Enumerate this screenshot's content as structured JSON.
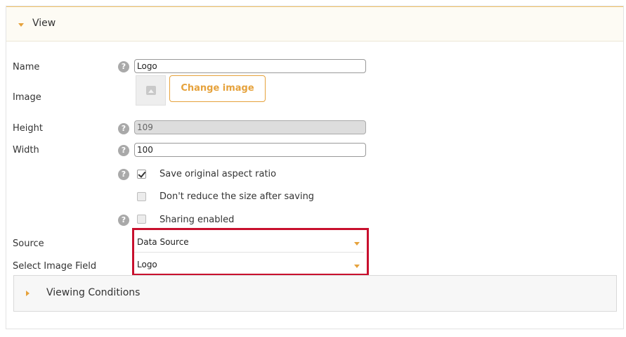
{
  "view_panel": {
    "title": "View"
  },
  "fields": {
    "name": {
      "label": "Name",
      "value": "Logo"
    },
    "image": {
      "label": "Image",
      "button_label": "Change image"
    },
    "height": {
      "label": "Height",
      "value": "109"
    },
    "width": {
      "label": "Width",
      "value": "100"
    },
    "source": {
      "label": "Source",
      "value": "Data Source"
    },
    "select_image_field": {
      "label": "Select Image Field",
      "value": "Logo"
    }
  },
  "checkboxes": {
    "save_aspect_ratio": {
      "label": "Save original aspect ratio",
      "checked": true
    },
    "dont_reduce_size": {
      "label": "Don't reduce the size after saving",
      "checked": false
    },
    "sharing_enabled": {
      "label": "Sharing enabled",
      "checked": false
    }
  },
  "help_icon": {
    "glyph": "?"
  },
  "viewing_conditions": {
    "title": "Viewing Conditions"
  },
  "colors": {
    "accent": "#e6a23c",
    "highlight": "#c8102e",
    "help_icon": "#a9a9a9"
  },
  "icons": {
    "expand_down": "triangle-down-icon",
    "collapse_right": "triangle-right-icon",
    "help": "question-circle-icon",
    "image_placeholder": "image-placeholder-icon"
  }
}
